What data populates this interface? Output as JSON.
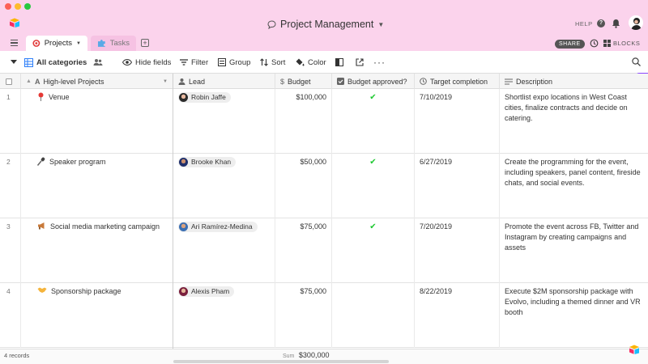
{
  "window": {
    "base_title": "Project Management",
    "help_label": "HELP"
  },
  "tabs": [
    {
      "label": "Projects",
      "active": true
    },
    {
      "label": "Tasks",
      "active": false
    }
  ],
  "tabbar": {
    "share_label": "SHARE",
    "blocks_label": "BLOCKS"
  },
  "toolbar": {
    "view_name": "All categories",
    "hide_fields": "Hide fields",
    "filter": "Filter",
    "group": "Group",
    "sort": "Sort",
    "color": "Color"
  },
  "columns": {
    "project": "High-level Projects",
    "lead": "Lead",
    "budget": "Budget",
    "approved": "Budget approved?",
    "target": "Target completion",
    "description": "Description"
  },
  "rows": [
    {
      "num": "1",
      "icon": "pin-icon",
      "project": "Venue",
      "lead": "Robin Jaffe",
      "budget": "$100,000",
      "approved": "✔",
      "target": "7/10/2019",
      "description": "Shortlist expo locations in West Coast cities, finalize contracts and decide on catering."
    },
    {
      "num": "2",
      "icon": "microphone-icon",
      "project": "Speaker program",
      "lead": "Brooke Khan",
      "budget": "$50,000",
      "approved": "✔",
      "target": "6/27/2019",
      "description": "Create the programming for the event, including speakers, panel content, fireside chats, and social events."
    },
    {
      "num": "3",
      "icon": "megaphone-icon",
      "project": "Social media marketing campaign",
      "lead": "Ari Ramírez-Medina",
      "budget": "$75,000",
      "approved": "✔",
      "target": "7/20/2019",
      "description": "Promote the event across FB, Twitter and Instagram by creating campaigns and assets"
    },
    {
      "num": "4",
      "icon": "handshake-icon",
      "project": "Sponsorship package",
      "lead": "Alexis Pham",
      "budget": "$75,000",
      "approved": "",
      "target": "8/22/2019",
      "description": "Execute $2M sponsorship package with Evolvo, including a themed dinner and VR booth"
    }
  ],
  "footer": {
    "records": "4 records",
    "sum_label": "Sum",
    "sum_value": "$300,000"
  },
  "colors": {
    "titlebar_bg": "#fbd3ec",
    "check_green": "#20c933",
    "accent_purple": "#8b46ff"
  }
}
